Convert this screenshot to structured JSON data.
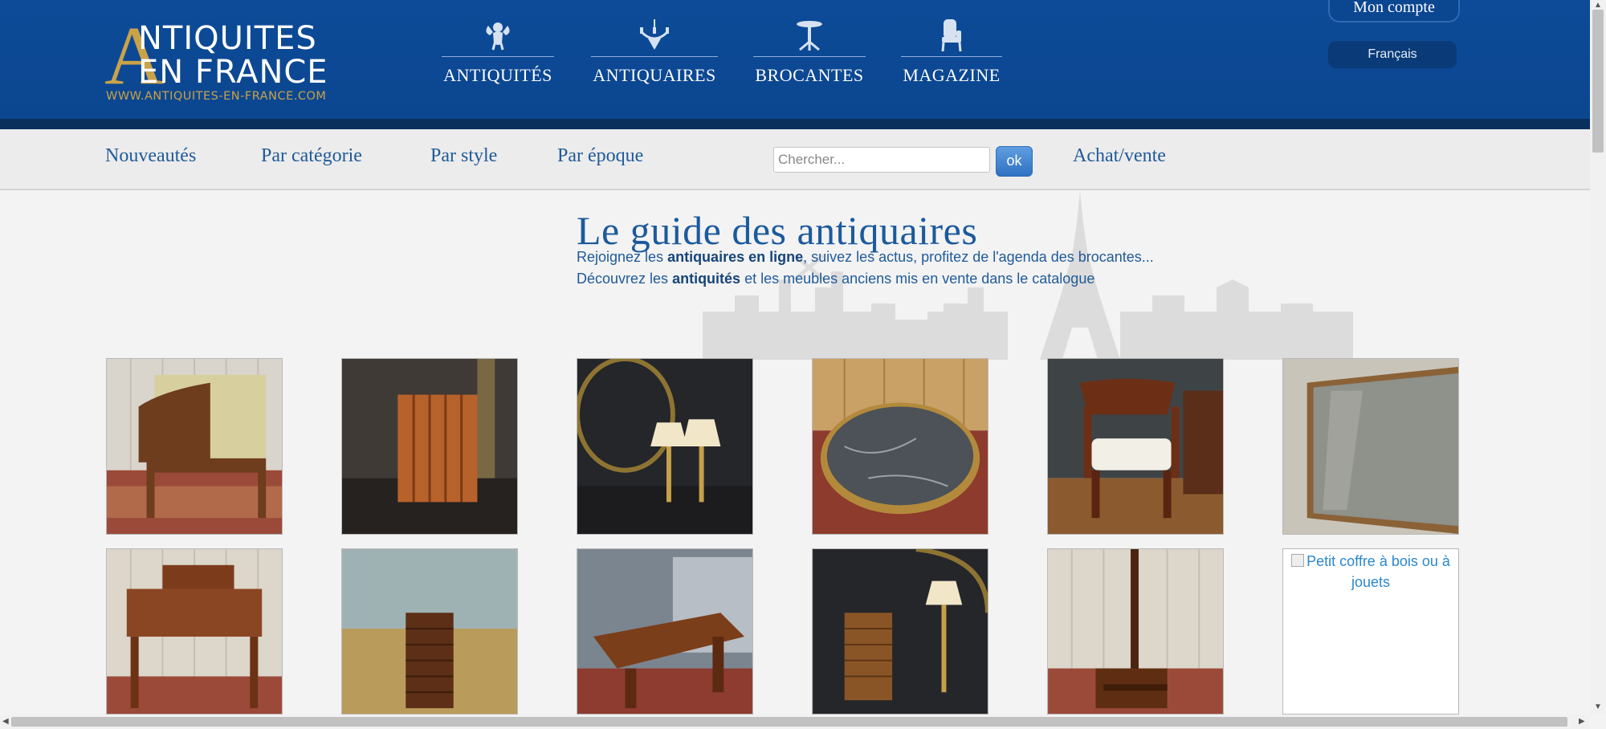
{
  "logo": {
    "big_letter": "A",
    "line1": "NTIQUITES",
    "line2": "EN FRANCE",
    "url": "WWW.ANTIQUITES-EN-FRANCE.COM"
  },
  "main_nav": [
    {
      "label": "ANTIQUITÉS",
      "icon": "cherub-icon"
    },
    {
      "label": "ANTIQUAIRES",
      "icon": "chandelier-icon"
    },
    {
      "label": "BROCANTES",
      "icon": "pedestal-table-icon"
    },
    {
      "label": "MAGAZINE",
      "icon": "armchair-icon"
    }
  ],
  "account": {
    "label": "Mon compte"
  },
  "language": {
    "label": "Français"
  },
  "subnav": {
    "nouveautes": "Nouveautés",
    "categorie": "Par catégorie",
    "style": "Par style",
    "epoque": "Par époque",
    "achat": "Achat/vente"
  },
  "search": {
    "placeholder": "Chercher...",
    "value": "",
    "button": "ok"
  },
  "guide": {
    "title": "Le guide des antiquaires",
    "line1_pre": "Rejoignez les ",
    "line1_bold": "antiquaires en ligne",
    "line1_post": ", suivez les actus, profitez de l'agenda des brocantes...",
    "line2_pre": "Découvrez les ",
    "line2_bold": "antiquités",
    "line2_post": " et les meubles anciens mis en vente dans le catalogue"
  },
  "gallery": {
    "broken_alt": "Petit coffre à bois ou à jouets"
  },
  "colors": {
    "header_blue": "#0d4b98",
    "gold": "#c9a24a",
    "link_blue": "#1f5a99"
  }
}
